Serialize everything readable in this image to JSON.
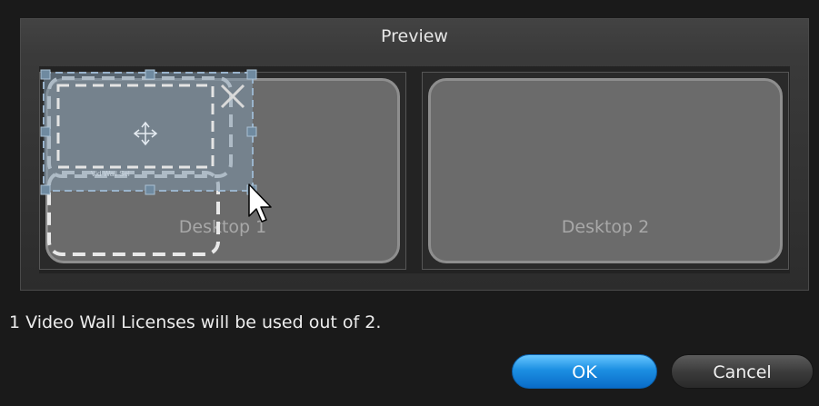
{
  "dialog": {
    "preview_title": "Preview",
    "desktops": [
      {
        "label": "Desktop 1"
      },
      {
        "label": "Desktop 2"
      }
    ],
    "overlay_caption": "Vid Wall Sel",
    "overlay_icons": [
      "move-icon",
      "close-icon",
      "resize-handle-icon",
      "mouse-cursor-icon"
    ],
    "license_message": "1 Video Wall Licenses will be used out of 2.",
    "buttons": {
      "ok_label": "OK",
      "cancel_label": "Cancel"
    },
    "colors": {
      "background": "#1a1a1a",
      "desktop_card": "#6b6b6b",
      "selection_fill": "#7e96aa",
      "selection_border": "#9ab4cc",
      "ok_accent": "#1c8fe2"
    }
  }
}
